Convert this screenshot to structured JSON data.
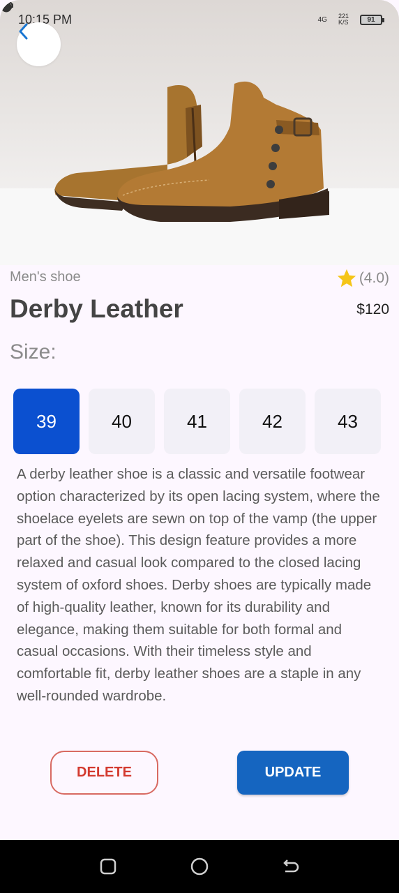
{
  "status_bar": {
    "time": "10:15 PM",
    "network_type": "4G",
    "data_speed": "221",
    "data_speed_unit": "K/S",
    "battery_level": "91"
  },
  "product": {
    "category": "Men's shoe",
    "rating": "(4.0)",
    "name": "Derby Leather",
    "price": "$120",
    "size_label": "Size:",
    "sizes": [
      "39",
      "40",
      "41",
      "42",
      "43"
    ],
    "selected_size": "39",
    "description": "A derby leather shoe is a classic and versatile footwear option characterized by its open lacing system, where the shoelace eyelets are sewn on top of the vamp (the upper part of the shoe). This design feature provides a more relaxed and casual look compared to the closed lacing system of oxford shoes. Derby shoes are typically made of high-quality leather, known for its durability and elegance, making them suitable for both formal and casual occasions. With their timeless style and comfortable fit, derby leather shoes are a staple in any well-rounded wardrobe."
  },
  "actions": {
    "delete_label": "DELETE",
    "update_label": "UPDATE"
  },
  "icons": {
    "back": "chevron-left-icon",
    "rating": "star-icon",
    "nav": [
      "square-icon",
      "circle-icon",
      "back-arrow-icon"
    ]
  },
  "colors": {
    "accent": "#0b50d0",
    "update_button": "#1565c0",
    "delete_text": "#d33a2f",
    "star": "#f5c518",
    "background": "#fdf7ff"
  }
}
